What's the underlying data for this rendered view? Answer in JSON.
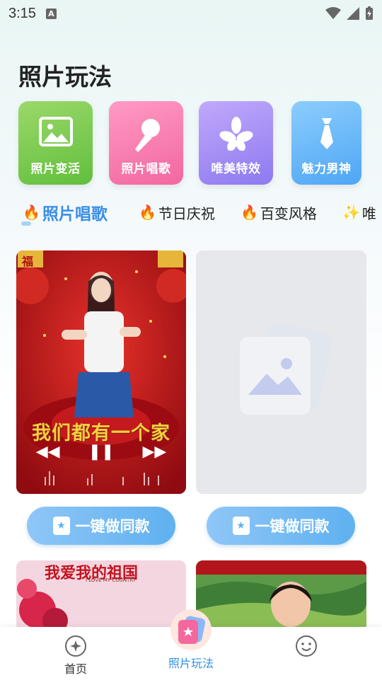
{
  "status_bar": {
    "time": "3:15",
    "notification_icon": "A"
  },
  "page": {
    "title": "照片玩法"
  },
  "categories": [
    {
      "label": "照片变活",
      "icon": "image-icon",
      "color_from": "#9bd86a",
      "color_to": "#61bf3c"
    },
    {
      "label": "照片唱歌",
      "icon": "microphone-icon",
      "color_from": "#ff9ac4",
      "color_to": "#f2679f"
    },
    {
      "label": "唯美特效",
      "icon": "flower-icon",
      "color_from": "#c0a9fb",
      "color_to": "#8e79f0"
    },
    {
      "label": "魅力男神",
      "icon": "tie-icon",
      "color_from": "#8ccdfd",
      "color_to": "#4ea6f5"
    }
  ],
  "tabs": [
    {
      "label": "照片唱歌",
      "icon": "flame-icon",
      "active": true
    },
    {
      "label": "节日庆祝",
      "icon": "flame-icon",
      "active": false
    },
    {
      "label": "百变风格",
      "icon": "flame-icon",
      "active": false
    },
    {
      "label": "唯",
      "icon": "sparkle-icon",
      "active": false
    }
  ],
  "cards": [
    {
      "lyric": "我们都有一个家",
      "button_label": "一键做同款",
      "thumb": "福"
    },
    {
      "placeholder": "image-placeholder-icon",
      "button_label": "一键做同款"
    }
  ],
  "cards_row2": [
    {
      "banner_text": "我爱我的祖国",
      "banner_sub": "I LOVE MY COUNTRY"
    },
    {
      "image": "landscape-portrait"
    }
  ],
  "bottom_nav": [
    {
      "label": "首页",
      "icon": "home-star-icon",
      "active": false
    },
    {
      "label": "照片玩法",
      "icon": "photo-play-icon",
      "active": true
    },
    {
      "label": "",
      "icon": "smiley-icon",
      "active": false
    }
  ]
}
